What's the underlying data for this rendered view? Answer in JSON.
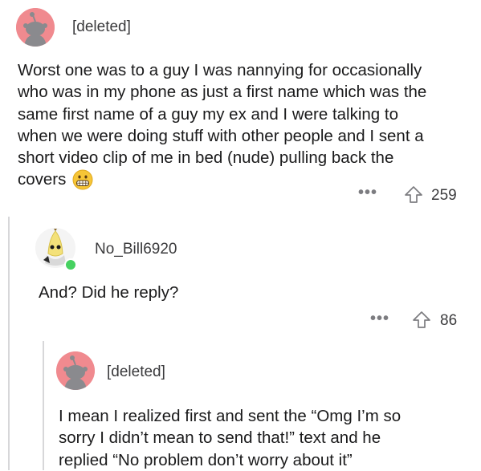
{
  "comments": [
    {
      "username": "[deleted]",
      "avatar_icon": "snoo-avatar-icon",
      "lines": [
        "Worst one was to a guy I was nannying for occasionally",
        "who was in my phone as just a first name which was the",
        "same first name of a guy my ex and I were talking to",
        "when we were doing stuff with other people and I sent a",
        "short video clip of me in bed (nude) pulling back the",
        "covers"
      ],
      "emoji": "grimacing-face-emoji",
      "more_label": "•••",
      "votes": "259"
    },
    {
      "username": "No_Bill6920",
      "avatar_icon": "banana-snoo-avatar-icon",
      "online": true,
      "lines": [
        "And? Did he reply?"
      ],
      "more_label": "•••",
      "votes": "86"
    },
    {
      "username": "[deleted]",
      "avatar_icon": "snoo-avatar-icon",
      "lines": [
        "I mean I realized first and sent the “Omg I’m so",
        "sorry I didn’t mean to send that!” text and he",
        "replied “No problem don’t worry about it”"
      ]
    }
  ],
  "colors": {
    "avatar_bg": "#f08a8f",
    "online_dot": "#46d160",
    "thread_line": "#d7d7d9"
  }
}
